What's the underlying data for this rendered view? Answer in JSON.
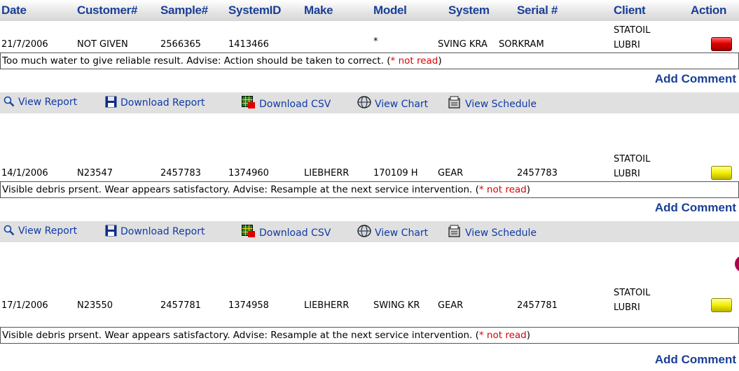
{
  "header": {
    "date": "Date",
    "customer": "Customer#",
    "sample": "Sample#",
    "systemid": "SystemID",
    "make": "Make",
    "model": "Model",
    "system": "System",
    "serial": "Serial #",
    "client": "Client",
    "action": "Action"
  },
  "records": [
    {
      "date": "21/7/2006",
      "customer": "NOT GIVEN",
      "sample": "2566365",
      "systemid": "1413466",
      "make": "",
      "model": "*",
      "system": "SVING KRA",
      "serial": "SORKRAM",
      "client_line1": "STATOIL",
      "client_line2": "LUBRI",
      "status_color": "red",
      "comment": "Too much water to give reliable result. Advise: Action should be taken to correct. (",
      "not_read": "* not read",
      "comment_close": ")",
      "add_comment": "Add Comment"
    },
    {
      "date": "14/1/2006",
      "customer": "N23547",
      "sample": "2457783",
      "systemid": "1374960",
      "make": "LIEBHERR",
      "model": "170109 H",
      "system": "GEAR",
      "serial": "2457783",
      "client_line1": "STATOIL",
      "client_line2": "LUBRI",
      "status_color": "yellow",
      "comment": "Visible debris prsent. Wear appears satisfactory. Advise: Resample at the next service intervention. (",
      "not_read": "* not read",
      "comment_close": ")",
      "add_comment": "Add Comment"
    },
    {
      "date": "17/1/2006",
      "customer": "N23550",
      "sample": "2457781",
      "systemid": "1374958",
      "make": "LIEBHERR",
      "model": "SWING KR",
      "system": "GEAR",
      "serial": "2457781",
      "client_line1": "STATOIL",
      "client_line2": "LUBRI",
      "status_color": "yellow",
      "comment": "Visible debris prsent. Wear appears satisfactory. Advise: Resample at the next service intervention. (",
      "not_read": "* not read",
      "comment_close": ")",
      "add_comment": "Add Comment"
    }
  ],
  "actions": {
    "view_report": "View Report",
    "download_report": "Download Report",
    "download_csv": "Download CSV",
    "view_chart": "View Chart",
    "view_schedule": "View Schedule"
  },
  "colors": {
    "header_text": "#1a3f96",
    "link": "#0f3aa6",
    "not_read": "#e00000",
    "bar_bg": "#e0e0e0"
  },
  "icons": [
    "magnifier-icon",
    "floppy-disk-icon",
    "csv-grid-icon",
    "chart-globe-icon",
    "schedule-icon"
  ]
}
